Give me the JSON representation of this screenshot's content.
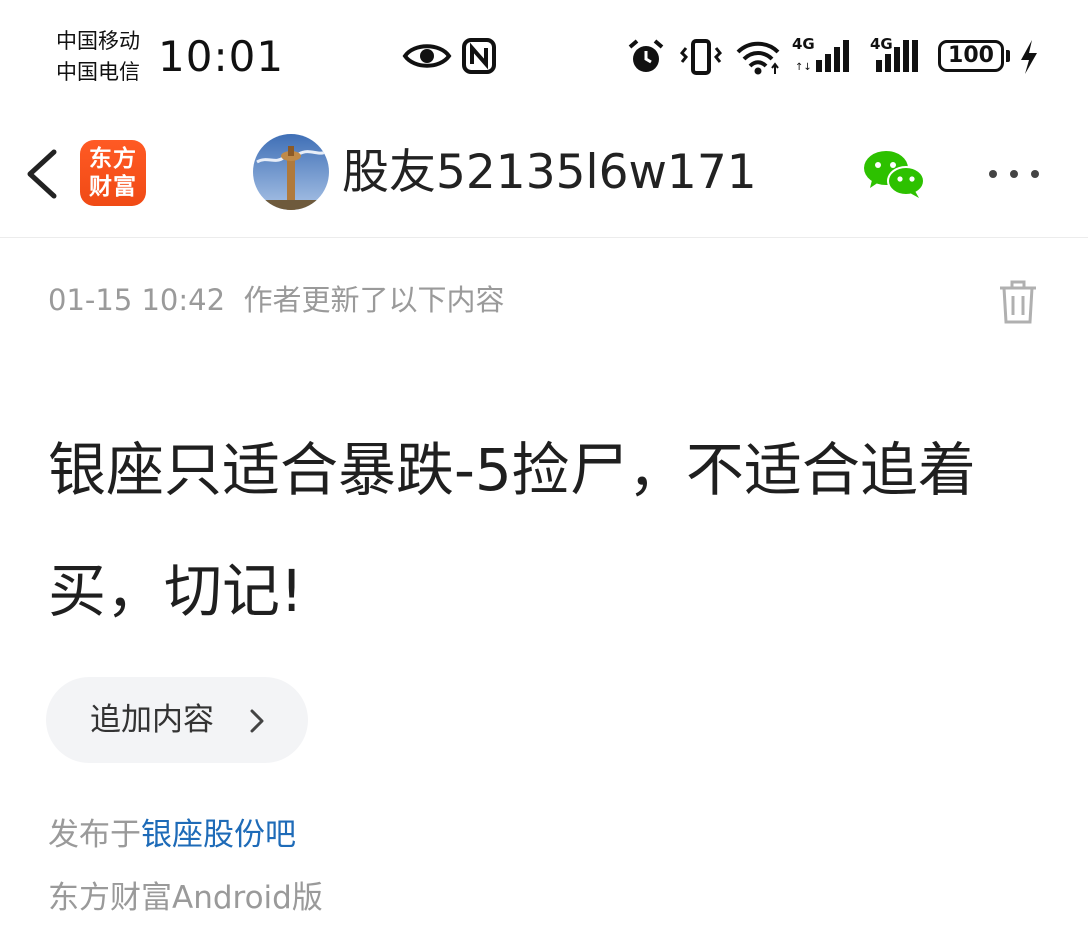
{
  "status_bar": {
    "carrier_1": "中国移动",
    "carrier_2": "中国电信",
    "time": "10:01",
    "network_1": "4G",
    "network_2": "4G",
    "battery": "100",
    "icons": [
      "eye-icon",
      "nfc-icon",
      "alarm-icon",
      "vibrate-icon",
      "wifi-icon",
      "signal-icon",
      "signal-icon",
      "charging-icon"
    ]
  },
  "nav": {
    "app_logo_text": "东方财富",
    "username": "股友52135l6w171",
    "icons": [
      "back-icon",
      "wechat-icon",
      "more-icon"
    ]
  },
  "post": {
    "timestamp": "01-15 10:42",
    "update_note": "作者更新了以下内容",
    "content": "银座只适合暴跌-5捡尸，不适合追着买，切记!",
    "append_button": "追加内容",
    "published_prefix": "发布于",
    "forum_name": "银座股份吧",
    "client": "东方财富Android版"
  },
  "colors": {
    "brand": "#f04a15",
    "link": "#1e6bb8",
    "wechat": "#2dc100",
    "muted_text": "#9a9a9a"
  }
}
